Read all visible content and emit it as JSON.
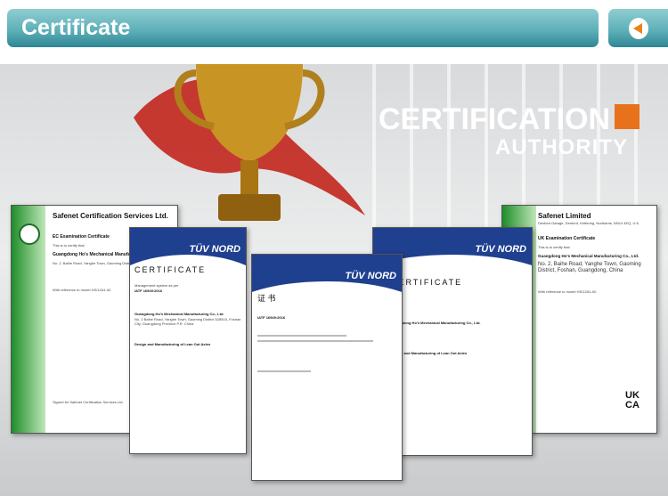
{
  "header": {
    "title": "Certificate",
    "back_icon": "arrow-left-circle-icon"
  },
  "hero": {
    "headline": "CERTIFICATION",
    "subheadline": "AUTHORITY",
    "accent": "#e8711c"
  },
  "certificates": [
    {
      "issuer": "Safenet Certification Services Ltd.",
      "type": "EC Examination Certificate",
      "intro": "This is to certify that",
      "company": "Guangdong Ho's Mechanical Manufacturing Co., Ltd.",
      "address": "No. 2, Baihe Road, Yanghe Town, Gaoming District, Guangdong, China",
      "model": "With reference to model HS/12A1-00",
      "signed": "Signed for Safenet Certification Services Ltd."
    },
    {
      "issuer": "TÜV NORD",
      "title": "CERTIFICATE",
      "standard_label": "Management system as per",
      "standard": "IATF 16949:2016",
      "company": "Guangdong Ho's Mechanical Manufacturing Co., Ltd.",
      "address": "No. 2 Baihe Road, Yanghe Town, Gaoming District 528515, Foshan City, Guangdong Province P.R. China",
      "scope": "Design and Manufacturing of Lean Out Axles"
    },
    {
      "issuer": "TÜV NORD",
      "title": "证 书",
      "standard": "IATF 16949:2016"
    },
    {
      "issuer": "TÜV NORD",
      "title": "CERTIFICATE",
      "company": "Guangdong Ho's Mechanical Manufacturing Co., Ltd.",
      "scope": "Design and Manufacturing of Lean Out Axles"
    },
    {
      "issuer": "Safenet Limited",
      "address_line": "Dexford Garage, Denford, Kettering, Northants, NN14 4EQ, U.K.",
      "type": "UK Examination Certificate",
      "intro": "This is to certify that",
      "company": "Guangdong Ho's Mechanical Manufacturing Co., Ltd.",
      "address": "No. 2, Baihe Road, Yanghe Town, Gaoming District, Foshan, Guangdong, China",
      "model": "With reference to model HS/12A1-00",
      "mark": "UK CA"
    }
  ]
}
